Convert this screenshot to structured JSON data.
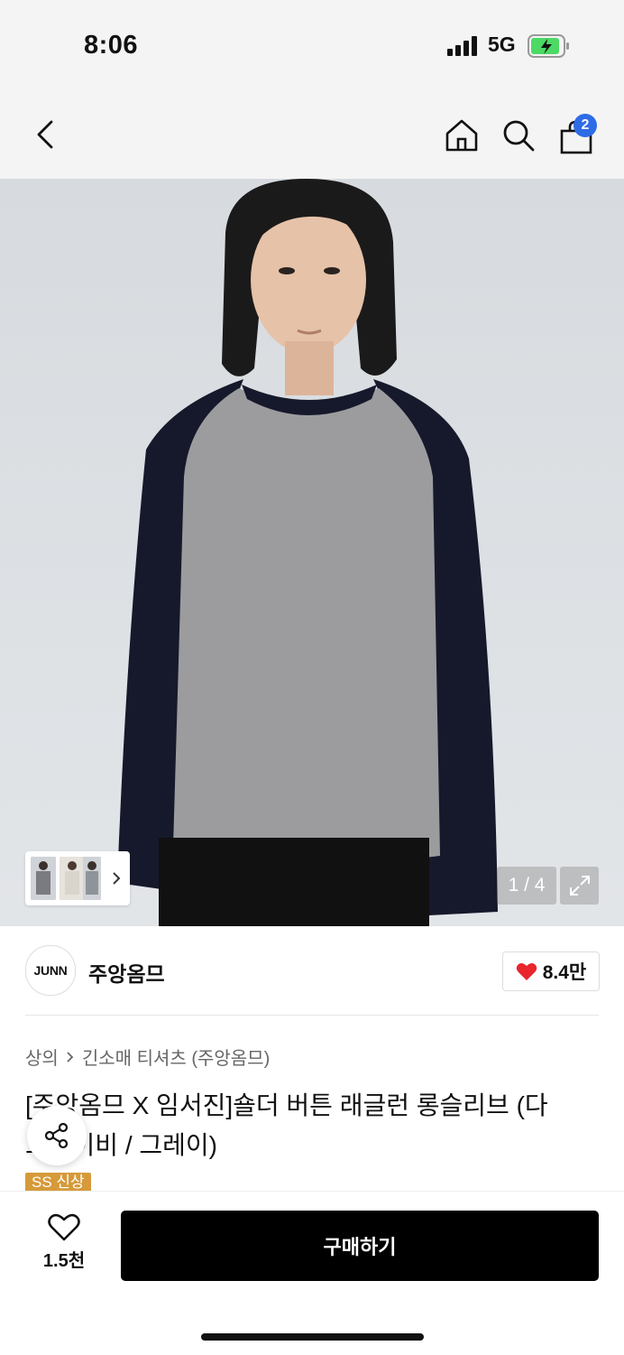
{
  "status_bar": {
    "time": "8:06",
    "network": "5G"
  },
  "nav": {
    "cart_count": "2"
  },
  "gallery": {
    "counter": "1 / 4"
  },
  "brand": {
    "logo_text": "JUNN",
    "name": "주앙옴므",
    "likes": "8.4만"
  },
  "breadcrumb": {
    "level1": "상의",
    "level2": "긴소매 티셔츠 (주앙옴므)"
  },
  "product": {
    "title_line1": "[주앙옴므 X 임서진]숄더 버튼 래글런 롱슬리브 (다",
    "title_line2": "크네이비 / 그레이)",
    "tag": "SS 신상"
  },
  "bottom": {
    "wish_count": "1.5천",
    "buy_label": "구매하기"
  },
  "colors": {
    "accent_blue": "#2e6be6",
    "heart_red": "#e8262c",
    "tag_orange": "#d69a3a"
  }
}
